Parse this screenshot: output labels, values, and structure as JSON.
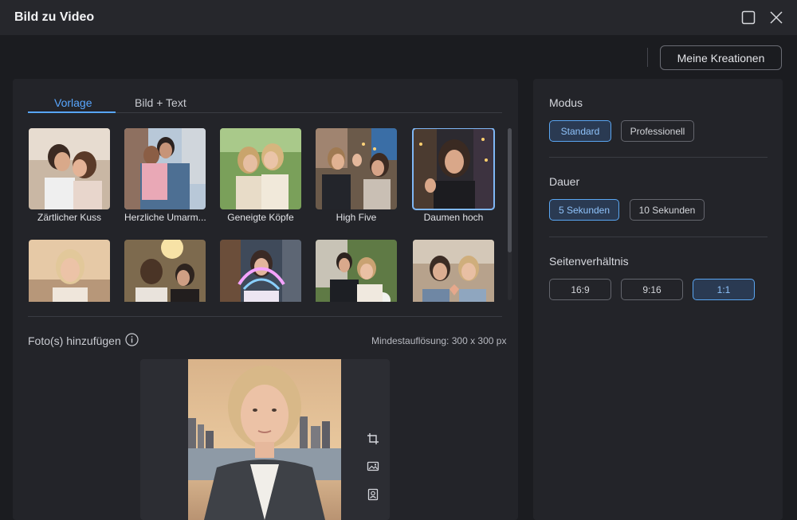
{
  "window": {
    "title": "Bild zu Video"
  },
  "toolbar": {
    "my_creations": "Meine Kreationen"
  },
  "tabs": [
    {
      "label": "Vorlage",
      "active": true
    },
    {
      "label": "Bild + Text",
      "active": false
    }
  ],
  "templates": [
    {
      "label": "Zärtlicher Kuss"
    },
    {
      "label": "Herzliche Umarm..."
    },
    {
      "label": "Geneigte Köpfe"
    },
    {
      "label": "High Five"
    },
    {
      "label": "Daumen hoch",
      "selected": true
    },
    {
      "label": ""
    },
    {
      "label": ""
    },
    {
      "label": ""
    },
    {
      "label": ""
    },
    {
      "label": ""
    }
  ],
  "upload": {
    "label": "Foto(s) hinzufügen",
    "min_resolution": "Mindestauflösung: 300 x 300 px"
  },
  "settings": {
    "mode": {
      "title": "Modus",
      "options": [
        "Standard",
        "Professionell"
      ],
      "selected": "Standard"
    },
    "duration": {
      "title": "Dauer",
      "options": [
        "5 Sekunden",
        "10 Sekunden"
      ],
      "selected": "5 Sekunden"
    },
    "aspect": {
      "title": "Seitenverhältnis",
      "options": [
        "16:9",
        "9:16",
        "1:1"
      ],
      "selected": "1:1"
    }
  },
  "colors": {
    "accent": "#58a6ff",
    "active_button_bg": "#2a3a52",
    "panel_bg": "#232429",
    "window_bg": "#1b1c20"
  }
}
